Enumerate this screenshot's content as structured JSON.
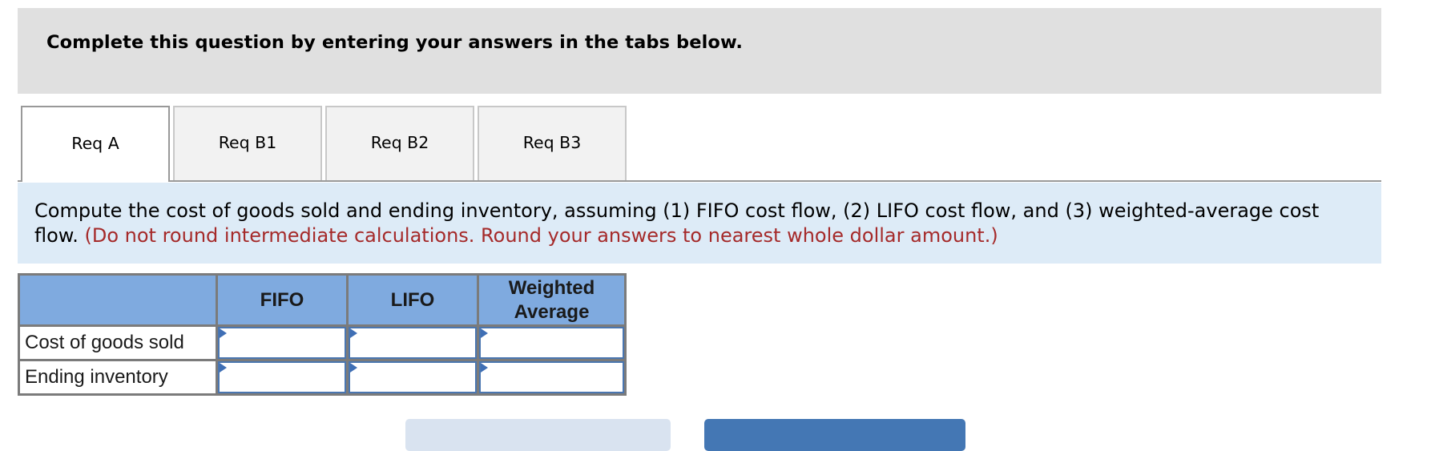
{
  "banner": {
    "text": "Complete this question by entering your answers in the tabs below."
  },
  "tabs": [
    {
      "label": "Req A",
      "active": true
    },
    {
      "label": "Req B1",
      "active": false
    },
    {
      "label": "Req B2",
      "active": false
    },
    {
      "label": "Req B3",
      "active": false
    }
  ],
  "instructions": {
    "main": "Compute the cost of goods sold and ending inventory, assuming (1) FIFO cost flow, (2) LIFO cost flow, and (3) weighted-average cost flow.",
    "note": "(Do not round intermediate calculations. Round your answers to nearest whole dollar amount.)"
  },
  "table": {
    "headers": {
      "label": "",
      "fifo": "FIFO",
      "lifo": "LIFO",
      "weighted_line1": "Weighted",
      "weighted_line2": "Average"
    },
    "rows": [
      {
        "label": "Cost of goods sold",
        "fifo": "",
        "lifo": "",
        "weighted_average": ""
      },
      {
        "label": "Ending inventory",
        "fifo": "",
        "lifo": "",
        "weighted_average": ""
      }
    ]
  },
  "colors": {
    "banner_bg": "#e0e0e0",
    "instructions_bg": "#ddebf7",
    "note_text": "#a52a2a",
    "table_header_bg": "#7faadf",
    "input_border": "#4a76b0",
    "next_button_bg": "#4477b4",
    "prev_button_bg": "#d9e3f0"
  }
}
